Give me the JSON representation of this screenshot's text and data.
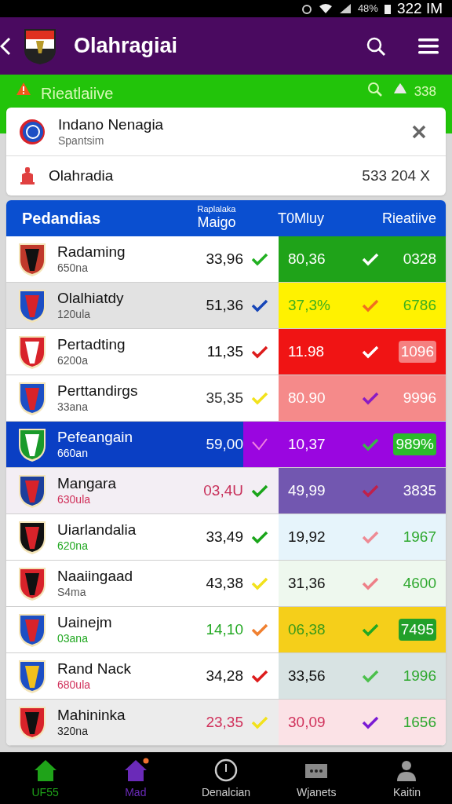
{
  "status_bar": {
    "battery": "48%",
    "time": "322 IM"
  },
  "app_bar": {
    "title": "Olahragiai"
  },
  "sub_bar": {
    "title": "Rieatlaiive",
    "count": "338"
  },
  "card": {
    "title": "Indano Nenagia",
    "subtitle": "Spantsim",
    "row_label": "Olahradia",
    "row_value": "533 204 X"
  },
  "table": {
    "columns": [
      {
        "label": "Pedandias"
      },
      {
        "over": "Raplalaka",
        "label": "Maigo"
      },
      {
        "label": "T0Mluy"
      },
      {
        "label": "Rieatiive"
      }
    ],
    "rows": [
      {
        "name": "Radaming",
        "sub": {
          "text": "650na",
          "color": "#555555"
        },
        "selected": false,
        "shade": {
          "color": "#ffffff"
        },
        "v1": {
          "text": "33,96",
          "color": "#111111"
        },
        "check1": {
          "color": "#22b022"
        },
        "color": "#1fa319",
        "v2": {
          "text": "80,36",
          "color": "#ffffff"
        },
        "check2": {
          "color": "#ffffff"
        },
        "v3": {
          "text": "0328",
          "color": "#ffffff"
        }
      },
      {
        "name": "Olalhiatdy",
        "sub": {
          "text": "120ula",
          "color": "#555555"
        },
        "selected": false,
        "shade": {
          "color": "#e2e2e2"
        },
        "v1": {
          "text": "51,36",
          "color": "#111111"
        },
        "check1": {
          "color": "#1746b8"
        },
        "color": "#fff200",
        "v2": {
          "text": "37,3%",
          "color": "#3cb01e"
        },
        "check2": {
          "color": "#f07020"
        },
        "v3": {
          "text": "6786",
          "color": "#3cb01e"
        }
      },
      {
        "name": "Pertadting",
        "sub": {
          "text": "6200a",
          "color": "#555555"
        },
        "selected": false,
        "shade": {
          "color": "#ffffff"
        },
        "v1": {
          "text": "11,35",
          "color": "#111111"
        },
        "check1": {
          "color": "#dd1c1c"
        },
        "color": "#f01414",
        "v2": {
          "text": "11.98",
          "color": "#ffffff"
        },
        "check2": {
          "color": "#ffffff"
        },
        "v3": {
          "text": "1096",
          "color": "#ffffff",
          "badge": {
            "color": "#f58080"
          }
        }
      },
      {
        "name": "Perttandirgs",
        "sub": {
          "text": "33ana",
          "color": "#555555"
        },
        "selected": false,
        "shade": {
          "color": "#ffffff"
        },
        "v1": {
          "text": "35,35",
          "color": "#333333"
        },
        "check1": {
          "color": "#f2e21c"
        },
        "color": "#f58a8a",
        "v2": {
          "text": "80.90",
          "color": "#ffffff"
        },
        "check2": {
          "color": "#8a1bc4"
        },
        "v3": {
          "text": "9996",
          "color": "#ffffff"
        }
      },
      {
        "name": "Pefeangain",
        "sub": {
          "text": "660an",
          "color": "#ffffff"
        },
        "selected": true,
        "shade": {
          "color": "#0a3fc4"
        },
        "v1": {
          "text": "59,00",
          "color": "#ffffff"
        },
        "check1": {
          "color": "#f080e0"
        },
        "color": "#9a06e0",
        "v2": {
          "text": "10,37",
          "color": "#ffffff"
        },
        "check2": {
          "color": "#3cb44a"
        },
        "v3": {
          "text": "989%",
          "color": "#ffffff",
          "badge": {
            "color": "#2bbb2b"
          }
        }
      },
      {
        "name": "Mangara",
        "sub": {
          "text": "630ula",
          "color": "#d0305a"
        },
        "selected": false,
        "shade": {
          "color": "#f3eef4"
        },
        "v1": {
          "text": "03,4U",
          "color": "#c8305a"
        },
        "check1": {
          "color": "#1aa51a"
        },
        "color": "#7257b0",
        "v2": {
          "text": "49,99",
          "color": "#ffffff"
        },
        "check2": {
          "color": "#c0204a"
        },
        "v3": {
          "text": "3835",
          "color": "#ffffff"
        }
      },
      {
        "name": "Uiarlandalia",
        "sub": {
          "text": "620na",
          "color": "#22a822"
        },
        "selected": false,
        "shade": {
          "color": "#ffffff"
        },
        "v1": {
          "text": "33,49",
          "color": "#111111"
        },
        "check1": {
          "color": "#1aa51a"
        },
        "color": "#e6f4fb",
        "v2": {
          "text": "19,92",
          "color": "#111111"
        },
        "check2": {
          "color": "#ee8a94"
        },
        "v3": {
          "text": "1967",
          "color": "#2ea82e"
        }
      },
      {
        "name": "Naaiingaad",
        "sub": {
          "text": "S4ma",
          "color": "#555555"
        },
        "selected": false,
        "shade": {
          "color": "#ffffff"
        },
        "v1": {
          "text": "43,38",
          "color": "#111111"
        },
        "check1": {
          "color": "#f2e21c"
        },
        "color": "#eef8ee",
        "v2": {
          "text": "31,36",
          "color": "#111111"
        },
        "check2": {
          "color": "#ee8088"
        },
        "v3": {
          "text": "4600",
          "color": "#2ea82e"
        }
      },
      {
        "name": "Uainejm",
        "sub": {
          "text": "03ana",
          "color": "#22a822"
        },
        "selected": false,
        "shade": {
          "color": "#ffffff"
        },
        "v1": {
          "text": "14,10",
          "color": "#22a822"
        },
        "check1": {
          "color": "#f08030"
        },
        "color": "#f5cf1a",
        "v2": {
          "text": "06,38",
          "color": "#3a9a1a"
        },
        "check2": {
          "color": "#22a822"
        },
        "v3": {
          "text": "7495",
          "color": "#ffffff",
          "badge": {
            "color": "#22a02a"
          }
        }
      },
      {
        "name": "Rand Nack",
        "sub": {
          "text": "680ula",
          "color": "#d0305a"
        },
        "selected": false,
        "shade": {
          "color": "#ffffff"
        },
        "v1": {
          "text": "34,28",
          "color": "#111111"
        },
        "check1": {
          "color": "#dd1c1c"
        },
        "color": "#d8e3e3",
        "v2": {
          "text": "33,56",
          "color": "#111111"
        },
        "check2": {
          "color": "#4cc04c"
        },
        "v3": {
          "text": "1996",
          "color": "#2ea82e"
        }
      },
      {
        "name": "Mahininka",
        "sub": {
          "text": "320na",
          "color": "#222222"
        },
        "selected": false,
        "shade": {
          "color": "#ececec"
        },
        "v1": {
          "text": "23,35",
          "color": "#d0305a"
        },
        "check1": {
          "color": "#f2e21c"
        },
        "color": "#fbe2e6",
        "v2": {
          "text": "30,09",
          "color": "#d0305a"
        },
        "check2": {
          "color": "#7a1bd4"
        },
        "v3": {
          "text": "1656",
          "color": "#2ea82e"
        }
      }
    ]
  },
  "bottom_nav": [
    {
      "label": "UF55",
      "kind": "home",
      "color": "#1fa319",
      "selected": false
    },
    {
      "label": "Mad",
      "kind": "home",
      "color": "#6a2ab8",
      "selected": true
    },
    {
      "label": "Denalcian",
      "kind": "clock",
      "color": "#cccccc",
      "selected": false
    },
    {
      "label": "Wjanets",
      "kind": "chat",
      "color": "#cccccc",
      "selected": false
    },
    {
      "label": "Kaitin",
      "kind": "person",
      "color": "#cccccc",
      "selected": false
    }
  ]
}
